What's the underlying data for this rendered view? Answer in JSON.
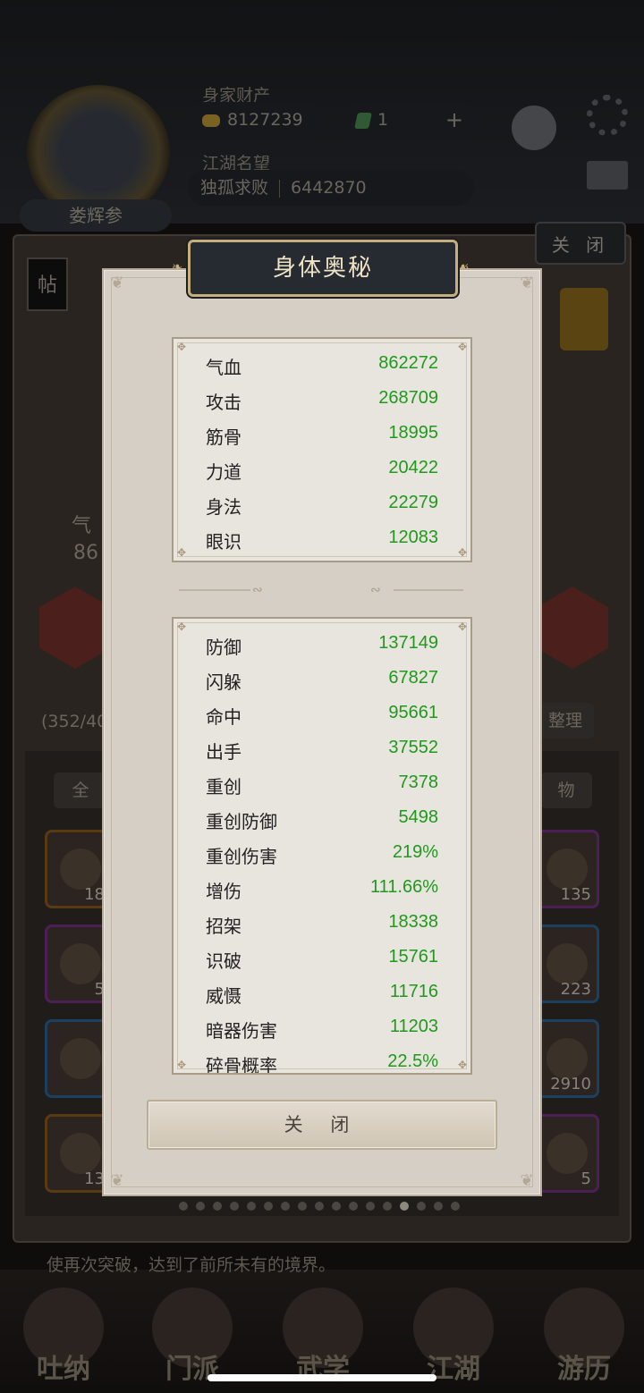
{
  "header": {
    "assets_label": "身家财产",
    "gold_amount": "8127239",
    "jade_amount": "1",
    "fame_label": "江湖名望",
    "fame_title": "独孤求败",
    "fame_value": "6442870",
    "player_name": "娄辉参",
    "close_label": "关 闭"
  },
  "background": {
    "post_icon_label": "帖",
    "hp_label": "气",
    "hp_partial": "86",
    "capacity_partial": "(352/40",
    "organize_label": "整理",
    "filter_all": "全",
    "filter_items": "物",
    "item_counts": [
      "18",
      "135",
      "5",
      "223",
      "2910",
      "13",
      "5"
    ],
    "description": "使再次突破，达到了前所未有的境界。",
    "nav": [
      "吐纳",
      "门派",
      "武学",
      "江湖",
      "游历"
    ]
  },
  "modal": {
    "title": "身体奥秘",
    "base_stats": [
      {
        "name": "气血",
        "value": "862272"
      },
      {
        "name": "攻击",
        "value": "268709"
      },
      {
        "name": "筋骨",
        "value": "18995"
      },
      {
        "name": "力道",
        "value": "20422"
      },
      {
        "name": "身法",
        "value": "22279"
      },
      {
        "name": "眼识",
        "value": "12083"
      }
    ],
    "advanced_stats": [
      {
        "name": "防御",
        "value": "137149"
      },
      {
        "name": "闪躲",
        "value": "67827"
      },
      {
        "name": "命中",
        "value": "95661"
      },
      {
        "name": "出手",
        "value": "37552"
      },
      {
        "name": "重创",
        "value": "7378"
      },
      {
        "name": "重创防御",
        "value": "5498"
      },
      {
        "name": "重创伤害",
        "value": "219%"
      },
      {
        "name": "增伤",
        "value": "111.66%"
      },
      {
        "name": "招架",
        "value": "18338"
      },
      {
        "name": "识破",
        "value": "15761"
      },
      {
        "name": "威慑",
        "value": "11716"
      },
      {
        "name": "暗器伤害",
        "value": "11203"
      },
      {
        "name": "碎骨概率",
        "value": "22.5%"
      }
    ],
    "close_button_label": "关 闭"
  },
  "colors": {
    "stat_value": "#1f9a1c",
    "title_text": "#efe3c6",
    "modal_bg": "#d6cfc6"
  }
}
